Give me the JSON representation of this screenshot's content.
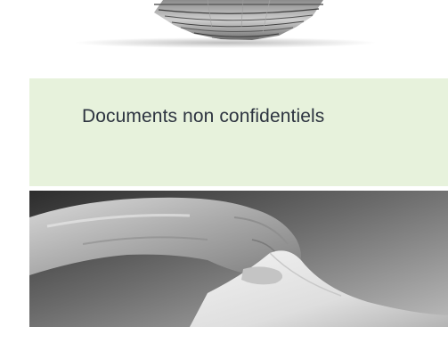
{
  "caption": {
    "text": "Documents non confidentiels",
    "background": "#e7f2dc",
    "color": "#2d3440"
  },
  "top_image": {
    "subject": "stack-of-folded-newspapers-photo"
  },
  "bottom_image": {
    "subject": "gloved-hand-holding-paper-photo"
  }
}
